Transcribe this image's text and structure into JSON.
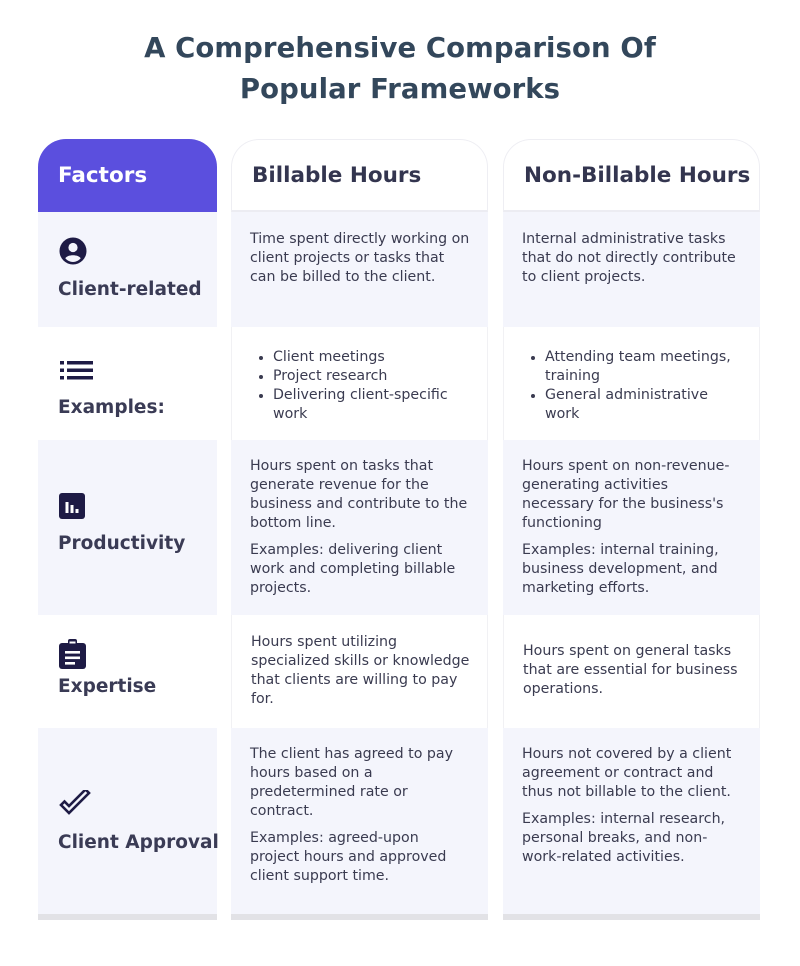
{
  "title_line1": "A Comprehensive Comparison Of",
  "title_line2": "Popular Frameworks",
  "colors": {
    "accent": "#5b4fde",
    "title": "#33475b",
    "text": "#3a3b50",
    "icon": "#1e1b45",
    "row_shade": "#f4f5fc"
  },
  "columns": {
    "factors": "Factors",
    "billable": "Billable Hours",
    "nonbillable": "Non-Billable Hours"
  },
  "rows": [
    {
      "icon": "user-circle-icon",
      "factor": "Client-related",
      "billable": [
        "Time spent directly working on client projects or tasks that can be billed to the client."
      ],
      "nonbillable": [
        "Internal administrative tasks that do not directly contribute to client projects."
      ]
    },
    {
      "icon": "list-icon",
      "factor": "Examples:",
      "billable_list": [
        "Client meetings",
        "Project research",
        "Delivering client-specific work"
      ],
      "nonbillable_list": [
        "Attending team meetings, training",
        "General administrative work"
      ]
    },
    {
      "icon": "bar-chart-icon",
      "factor": "Productivity",
      "billable": [
        "Hours spent on tasks that generate revenue for the business and contribute to the bottom line.",
        "Examples: delivering client work and completing billable projects."
      ],
      "nonbillable": [
        "Hours spent on non-revenue-generating activities necessary for the business's functioning",
        "Examples: internal training, business development, and marketing efforts."
      ]
    },
    {
      "icon": "clipboard-icon",
      "factor": "Expertise",
      "billable": [
        "Hours spent utilizing specialized skills or knowledge that clients are willing to pay for."
      ],
      "nonbillable": [
        "Hours spent on general tasks that are essential for business operations."
      ]
    },
    {
      "icon": "checkmark-icon",
      "factor": "Client Approval",
      "billable": [
        "The client has agreed to pay hours based on a predetermined rate or contract.",
        "Examples: agreed-upon project hours and approved client support time."
      ],
      "nonbillable": [
        "Hours not covered by a client agreement or contract and thus not billable to the client.",
        "Examples: internal research, personal breaks, and non-work-related activities."
      ]
    }
  ]
}
